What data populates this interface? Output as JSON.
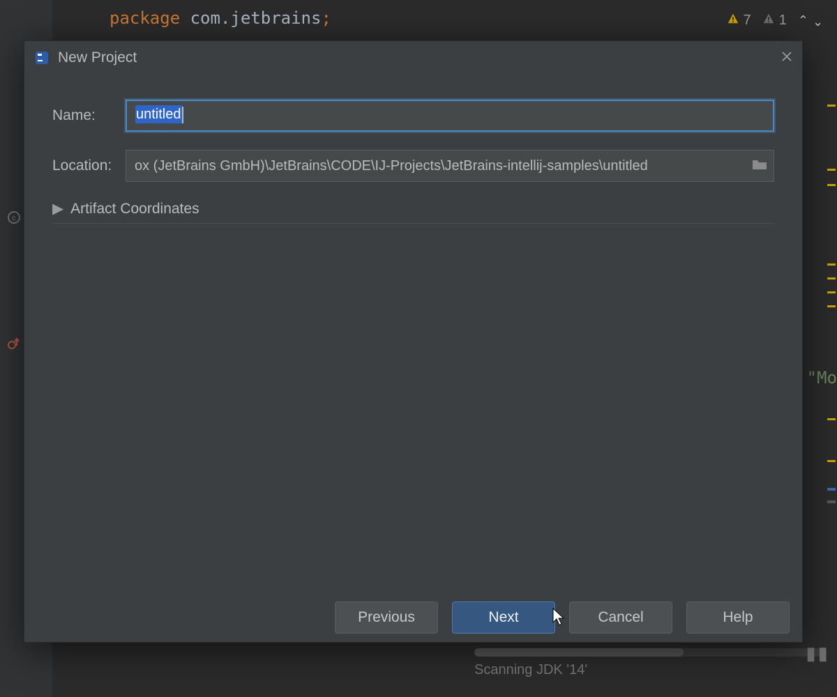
{
  "editor": {
    "package_kw": "package",
    "package_id": "com.jetbrains",
    "semicolon": ";",
    "inspections": {
      "warn1_count": "7",
      "warn2_count": "1"
    },
    "status_text": "Scanning JDK '14'",
    "peek_text": "\"Mo"
  },
  "dialog": {
    "title": "New Project",
    "name_label": "Name:",
    "name_value": "untitled",
    "location_label": "Location:",
    "location_value": "ox (JetBrains GmbH)\\JetBrains\\CODE\\IJ-Projects\\JetBrains-intellij-samples\\untitled",
    "artifact_label": "Artifact Coordinates",
    "buttons": {
      "previous": "Previous",
      "next": "Next",
      "cancel": "Cancel",
      "help": "Help"
    }
  }
}
